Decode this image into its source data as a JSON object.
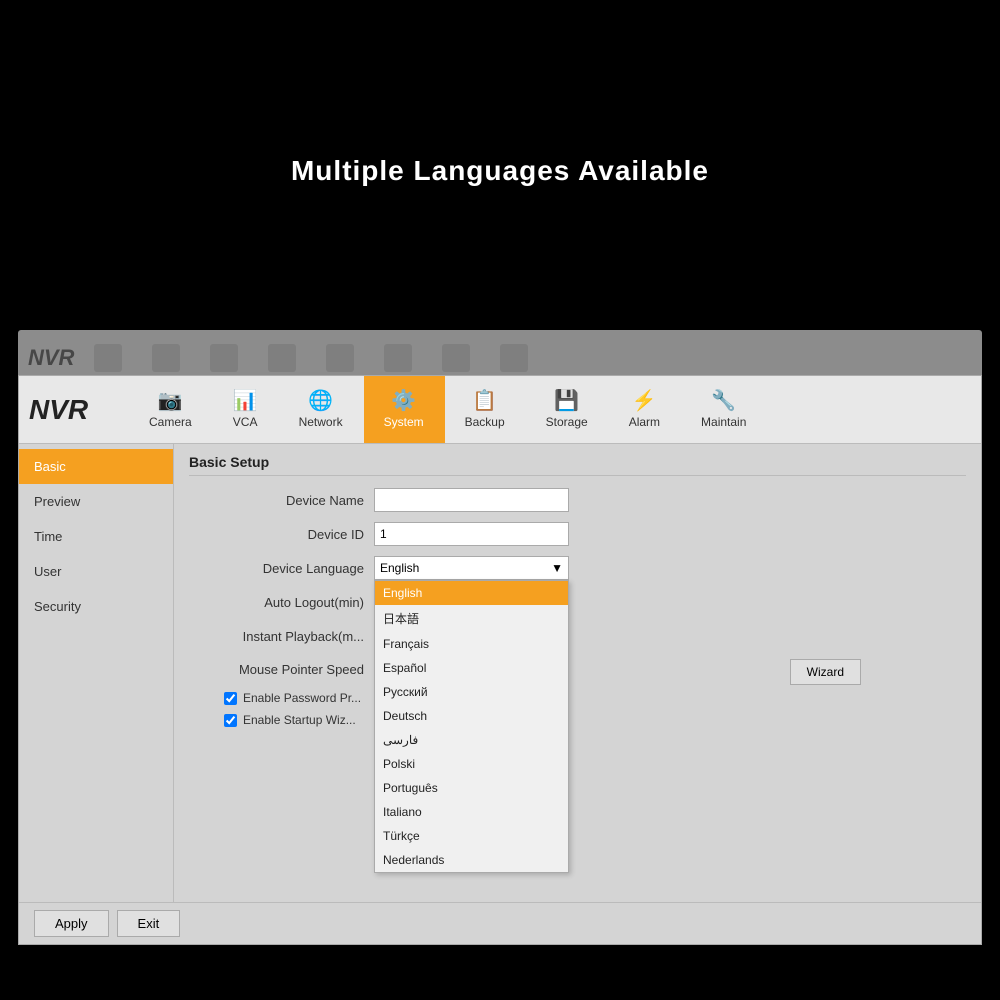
{
  "hero": {
    "title": "Multiple Languages Available"
  },
  "nav": {
    "logo": "NVR",
    "items": [
      {
        "id": "camera",
        "label": "Camera",
        "icon": "📷"
      },
      {
        "id": "vca",
        "label": "VCA",
        "icon": "📊"
      },
      {
        "id": "network",
        "label": "Network",
        "icon": "🌐"
      },
      {
        "id": "system",
        "label": "System",
        "icon": "⚙️",
        "active": true
      },
      {
        "id": "backup",
        "label": "Backup",
        "icon": "📋"
      },
      {
        "id": "storage",
        "label": "Storage",
        "icon": "💾"
      },
      {
        "id": "alarm",
        "label": "Alarm",
        "icon": "⚡"
      },
      {
        "id": "maintain",
        "label": "Maintain",
        "icon": "🔧"
      }
    ]
  },
  "sidebar": {
    "items": [
      {
        "id": "basic",
        "label": "Basic",
        "active": true
      },
      {
        "id": "preview",
        "label": "Preview"
      },
      {
        "id": "time",
        "label": "Time"
      },
      {
        "id": "user",
        "label": "User"
      },
      {
        "id": "security",
        "label": "Security"
      }
    ]
  },
  "section_title": "Basic Setup",
  "form": {
    "device_name_label": "Device Name",
    "device_name_value": "",
    "device_id_label": "Device ID",
    "device_id_value": "1",
    "device_language_label": "Device Language",
    "device_language_value": "English",
    "auto_logout_label": "Auto Logout(min)",
    "instant_playback_label": "Instant Playback(m...",
    "mouse_pointer_label": "Mouse Pointer Speed",
    "enable_password_label": "Enable Password Pr...",
    "enable_startup_label": "Enable Startup Wiz..."
  },
  "languages": [
    {
      "id": "english",
      "label": "English",
      "selected": true
    },
    {
      "id": "japanese",
      "label": "日本語"
    },
    {
      "id": "french",
      "label": "Français"
    },
    {
      "id": "spanish",
      "label": "Español"
    },
    {
      "id": "russian",
      "label": "Русский"
    },
    {
      "id": "german",
      "label": "Deutsch"
    },
    {
      "id": "arabic",
      "label": "فارسی"
    },
    {
      "id": "polish",
      "label": "Polski"
    },
    {
      "id": "portuguese",
      "label": "Português"
    },
    {
      "id": "italian",
      "label": "Italiano"
    },
    {
      "id": "turkish",
      "label": "Türkçe"
    },
    {
      "id": "dutch",
      "label": "Nederlands"
    }
  ],
  "buttons": {
    "wizard": "Wizard",
    "apply": "Apply",
    "exit": "Exit"
  }
}
